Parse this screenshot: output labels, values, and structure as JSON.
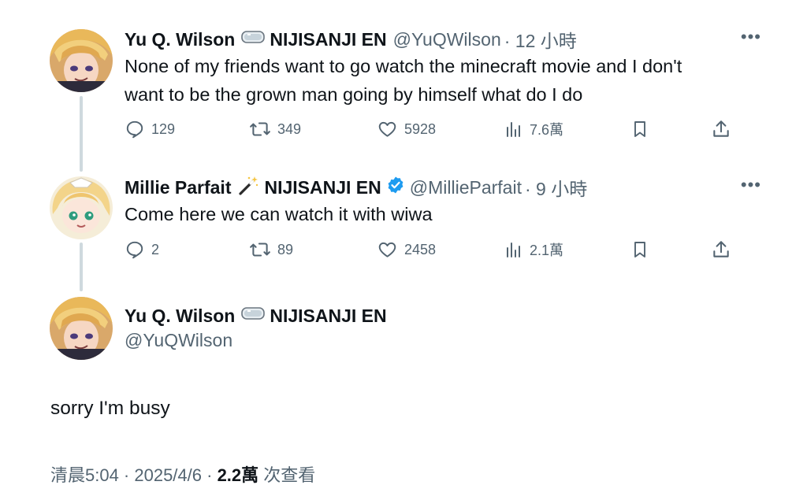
{
  "tweets": [
    {
      "name": "Yu Q. Wilson",
      "org": "NIJISANJI EN",
      "handle": "@YuQWilson",
      "time": "· 12 小時",
      "text_line1": "None of my friends want to go watch the minecraft movie and I don't",
      "text_line2": "want to be the grown man going by himself what do I do",
      "replies": "129",
      "retweets": "349",
      "likes": "5928",
      "views": "7.6萬"
    },
    {
      "name": "Millie Parfait",
      "org": "NIJISANJI EN",
      "handle": "@MillieParfait",
      "time": "· 9 小時",
      "text": "Come here we can watch it with wiwa",
      "replies": "2",
      "retweets": "89",
      "likes": "2458",
      "views": "2.1萬"
    }
  ],
  "main_tweet": {
    "name": "Yu Q. Wilson",
    "org": "NIJISANJI EN",
    "handle": "@YuQWilson",
    "text": "sorry I'm busy",
    "time": "清晨5:04 · 2025/4/6 · ",
    "views": "2.2萬",
    "views_suffix": " 次查看"
  },
  "icons": {
    "more": "more-horizontal-icon",
    "reply": "reply-icon",
    "retweet": "retweet-icon",
    "like": "heart-icon",
    "views": "views-icon",
    "bookmark": "bookmark-icon",
    "share": "share-icon",
    "goggles": "goggles-emoji-icon",
    "wand": "magic-wand-emoji-icon",
    "verified": "verified-badge-icon"
  },
  "colors": {
    "text": "#0f1419",
    "muted": "#536471",
    "verified": "#1d9bf0",
    "thread_line": "#cfd9de"
  }
}
